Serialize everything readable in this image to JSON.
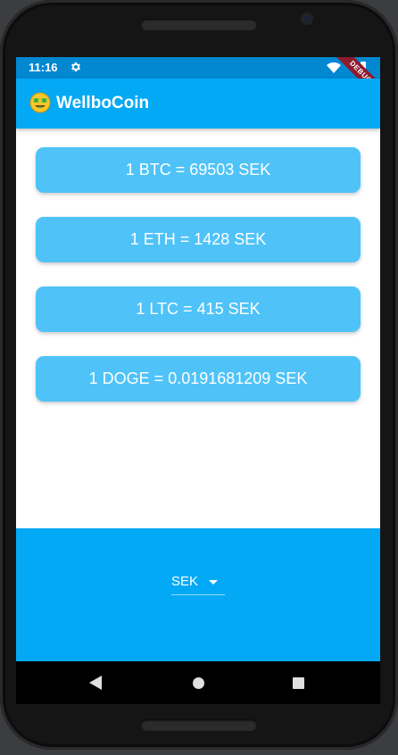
{
  "status_bar": {
    "time": "11:16",
    "debug_banner": "DEBUG"
  },
  "app_bar": {
    "title": "WellboCoin",
    "color": "#03a9f4"
  },
  "rates": [
    {
      "label": "1 BTC = 69503 SEK"
    },
    {
      "label": "1 ETH = 1428 SEK"
    },
    {
      "label": "1 LTC = 415 SEK"
    },
    {
      "label": "1 DOGE = 0.0191681209 SEK"
    }
  ],
  "currency_picker": {
    "selected": "SEK"
  },
  "colors": {
    "card": "#4fc3f7",
    "status_bar": "#0288d1",
    "primary": "#03a9f4"
  },
  "icons": {
    "status_settings": "gear-icon",
    "status_wifi": "wifi-icon",
    "status_battery": "battery-icon",
    "app_logo": "money-face-emoji-icon",
    "dropdown": "caret-down-icon",
    "nav_back": "back-triangle-icon",
    "nav_home": "home-circle-icon",
    "nav_recents": "recents-square-icon"
  }
}
